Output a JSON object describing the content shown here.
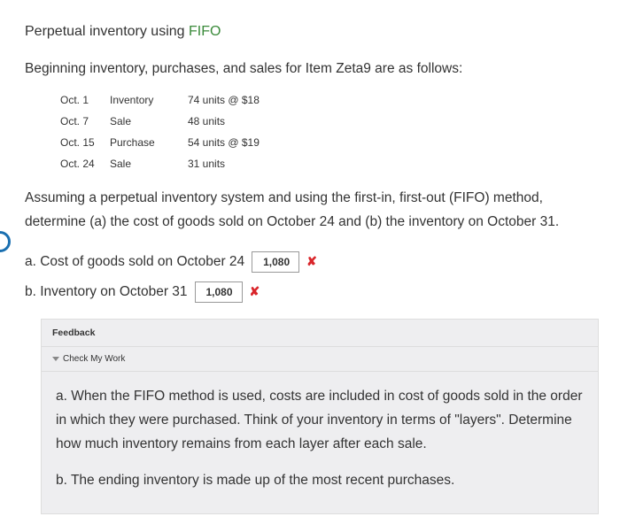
{
  "title_prefix": "Perpetual inventory using ",
  "title_method": "FIFO",
  "intro": "Beginning inventory, purchases, and sales for Item Zeta9 are as follows:",
  "inventory_rows": [
    {
      "date": "Oct. 1",
      "type": "Inventory",
      "detail": "74 units @ $18"
    },
    {
      "date": "Oct. 7",
      "type": "Sale",
      "detail": "48 units"
    },
    {
      "date": "Oct. 15",
      "type": "Purchase",
      "detail": "54 units @ $19"
    },
    {
      "date": "Oct. 24",
      "type": "Sale",
      "detail": "31 units"
    }
  ],
  "question": "Assuming a perpetual inventory system and using the first-in, first-out (FIFO) method, determine (a) the cost of goods sold on October 24 and (b) the inventory on October 31.",
  "answers": {
    "a": {
      "label": "a. Cost of goods sold on October 24",
      "value": "1,080",
      "mark": "✘"
    },
    "b": {
      "label": "b. Inventory on October 31",
      "value": "1,080",
      "mark": "✘"
    }
  },
  "feedback": {
    "header": "Feedback",
    "check_label": "Check My Work",
    "para_a": "a. When the FIFO method is used, costs are included in cost of goods sold in the order in which they were purchased. Think of your inventory in terms of \"layers\". Determine how much inventory remains from each layer after each sale.",
    "para_b": "b. The ending inventory is made up of the most recent purchases."
  }
}
